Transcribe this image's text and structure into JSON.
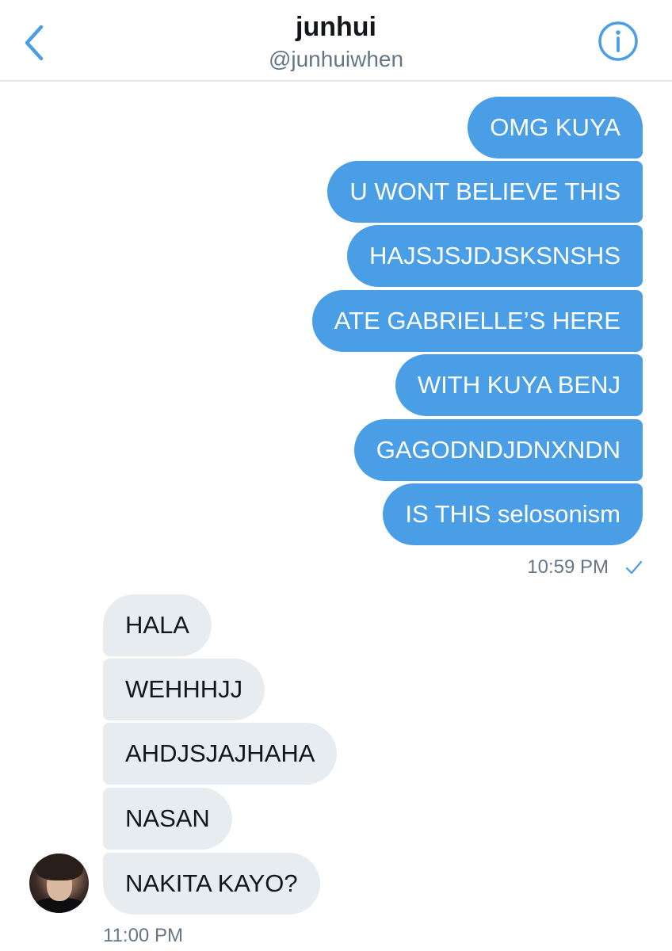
{
  "header": {
    "title": "junhui",
    "handle": "@junhuiwhen",
    "back_icon": "chevron-left-icon",
    "info_icon": "info-icon",
    "accent_color": "#4a9ee6"
  },
  "sent_messages": [
    {
      "text": "OMG KUYA"
    },
    {
      "text": "U WONT BELIEVE THIS"
    },
    {
      "text": "HAJSJSJDJSKSNSHS"
    },
    {
      "text": "ATE GABRIELLE’S HERE"
    },
    {
      "text": "WITH KUYA BENJ"
    },
    {
      "text": "GAGODNDJDNXNDN"
    },
    {
      "text": "IS THIS selosonism"
    }
  ],
  "sent_time": "10:59 PM",
  "sent_status_icon": "checkmark-icon",
  "received_messages": [
    {
      "text": "HALA"
    },
    {
      "text": "WEHHHJJ"
    },
    {
      "text": "AHDJSJAJHAHA"
    },
    {
      "text": "NASAN"
    },
    {
      "text": "NAKITA KAYO?"
    }
  ],
  "received_time": "11:00 PM",
  "colors": {
    "sent_bubble": "#4a9ee6",
    "received_bubble": "#e6ecf0",
    "timestamp": "#657786"
  }
}
